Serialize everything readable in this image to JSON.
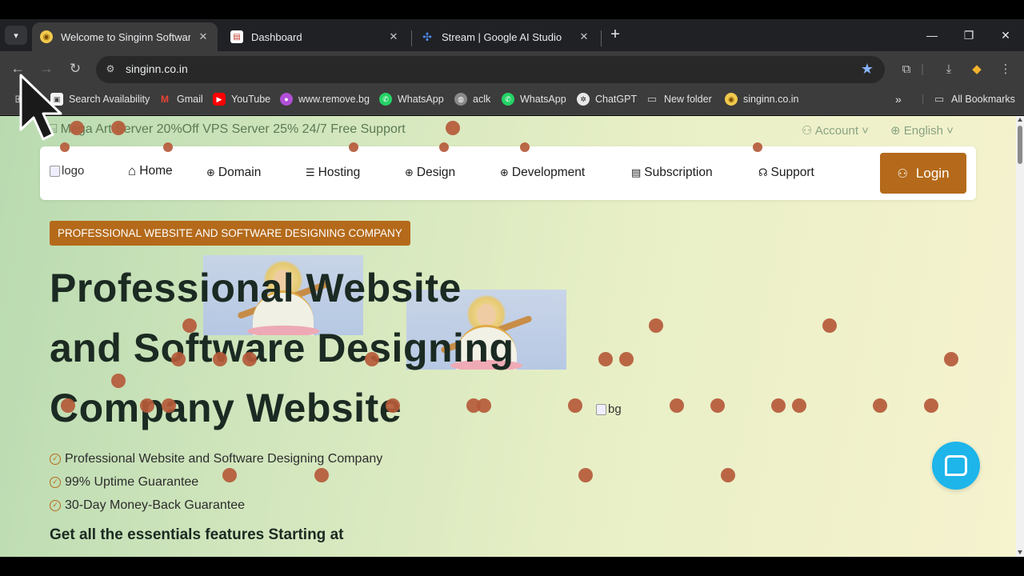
{
  "browser": {
    "tabs": [
      {
        "title": "Welcome to Singinn Software P",
        "active": true
      },
      {
        "title": "Dashboard",
        "active": false
      },
      {
        "title": "Stream | Google AI Studio",
        "active": false
      }
    ],
    "url": "singinn.co.in",
    "bookmarks": [
      "Search Availability",
      "Gmail",
      "YouTube",
      "www.remove.bg",
      "WhatsApp",
      "aclk",
      "WhatsApp",
      "ChatGPT",
      "New folder",
      "singinn.co.in"
    ],
    "all_bookmarks": "All Bookmarks",
    "chevron": "»"
  },
  "page": {
    "promo": "Mega Art Server 20%Off VPS Server 25% 24/7 Free Support",
    "account": "Account",
    "language": "English",
    "logo_alt": "logo",
    "nav": [
      "Home",
      "Domain",
      "Hosting",
      "Design",
      "Development",
      "Subscription",
      "Support"
    ],
    "login": "Login",
    "badge": "PROFESSIONAL WEBSITE AND SOFTWARE DESIGNING COMPANY",
    "headline_line1": "Professional Website",
    "headline_line2": "and Software Designing",
    "headline_line3_a": "Company",
    "headline_line3_b": "Website",
    "features": [
      "Professional Website and Software Designing Company",
      "99% Uptime Guarantee",
      "30-Day Money-Back Guarantee"
    ],
    "essentials": "Get all the essentials features Starting at",
    "bg_alt": "bg"
  },
  "colors": {
    "accent": "#b46a1a",
    "chat": "#1db5ea",
    "dot": "#b55a3a"
  }
}
